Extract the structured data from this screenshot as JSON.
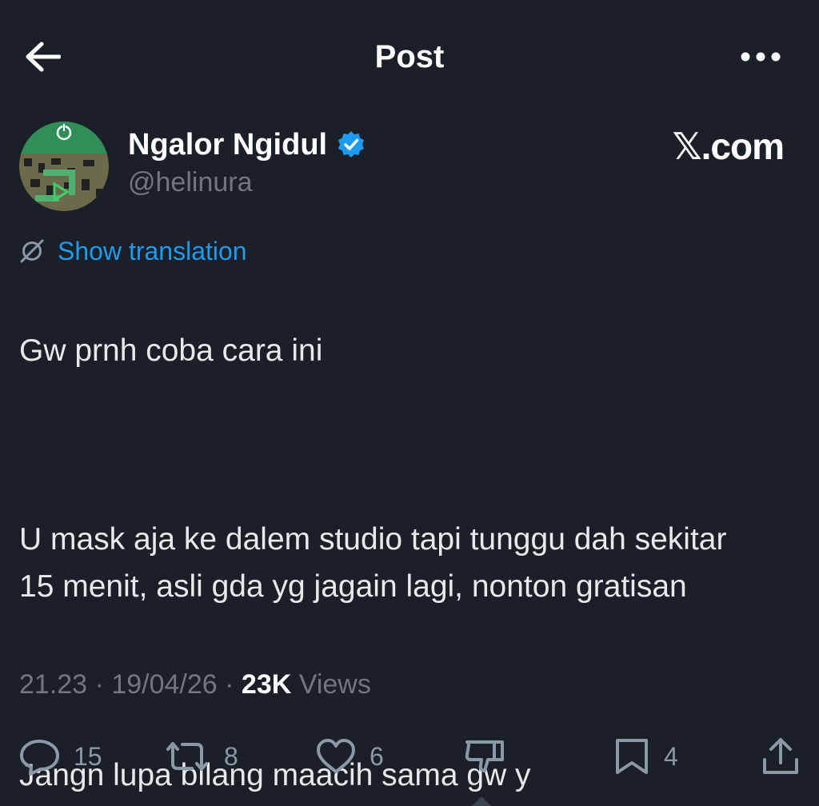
{
  "header": {
    "title": "Post",
    "back_icon": "arrow-left-icon",
    "more_icon": "more-horizontal-icon"
  },
  "author": {
    "name": "Ngalor Ngidul",
    "handle": "@helinura",
    "verified": true,
    "verified_color": "#1d9bf0"
  },
  "brand": {
    "label": "𝕏.com"
  },
  "translation": {
    "label": "Show translation",
    "icon": "globe-slash-icon"
  },
  "post": {
    "paragraphs": [
      "Gw prnh coba cara ini",
      "U mask aja ke dalem studio tapi tunggu dah sekitar 15 menit, asli gda yg jagain lagi, nonton gratisan",
      "Jangn lupa bilang maacih sama gw y"
    ]
  },
  "meta": {
    "time": "21.23",
    "date": "19/04/26",
    "separator": "·",
    "views_count": "23K",
    "views_label": "Views"
  },
  "actions": {
    "replies": {
      "icon": "reply-icon",
      "count": "15"
    },
    "reposts": {
      "icon": "repost-icon",
      "count": "8"
    },
    "likes": {
      "icon": "heart-icon",
      "count": "6"
    },
    "downvote": {
      "icon": "thumbs-down-icon"
    },
    "bookmarks": {
      "icon": "bookmark-icon",
      "count": "4"
    },
    "share": {
      "icon": "share-icon"
    }
  },
  "colors": {
    "background": "#1b1f27",
    "text": "#e7e9ea",
    "muted": "#71767b",
    "accent": "#1d9bf0"
  }
}
